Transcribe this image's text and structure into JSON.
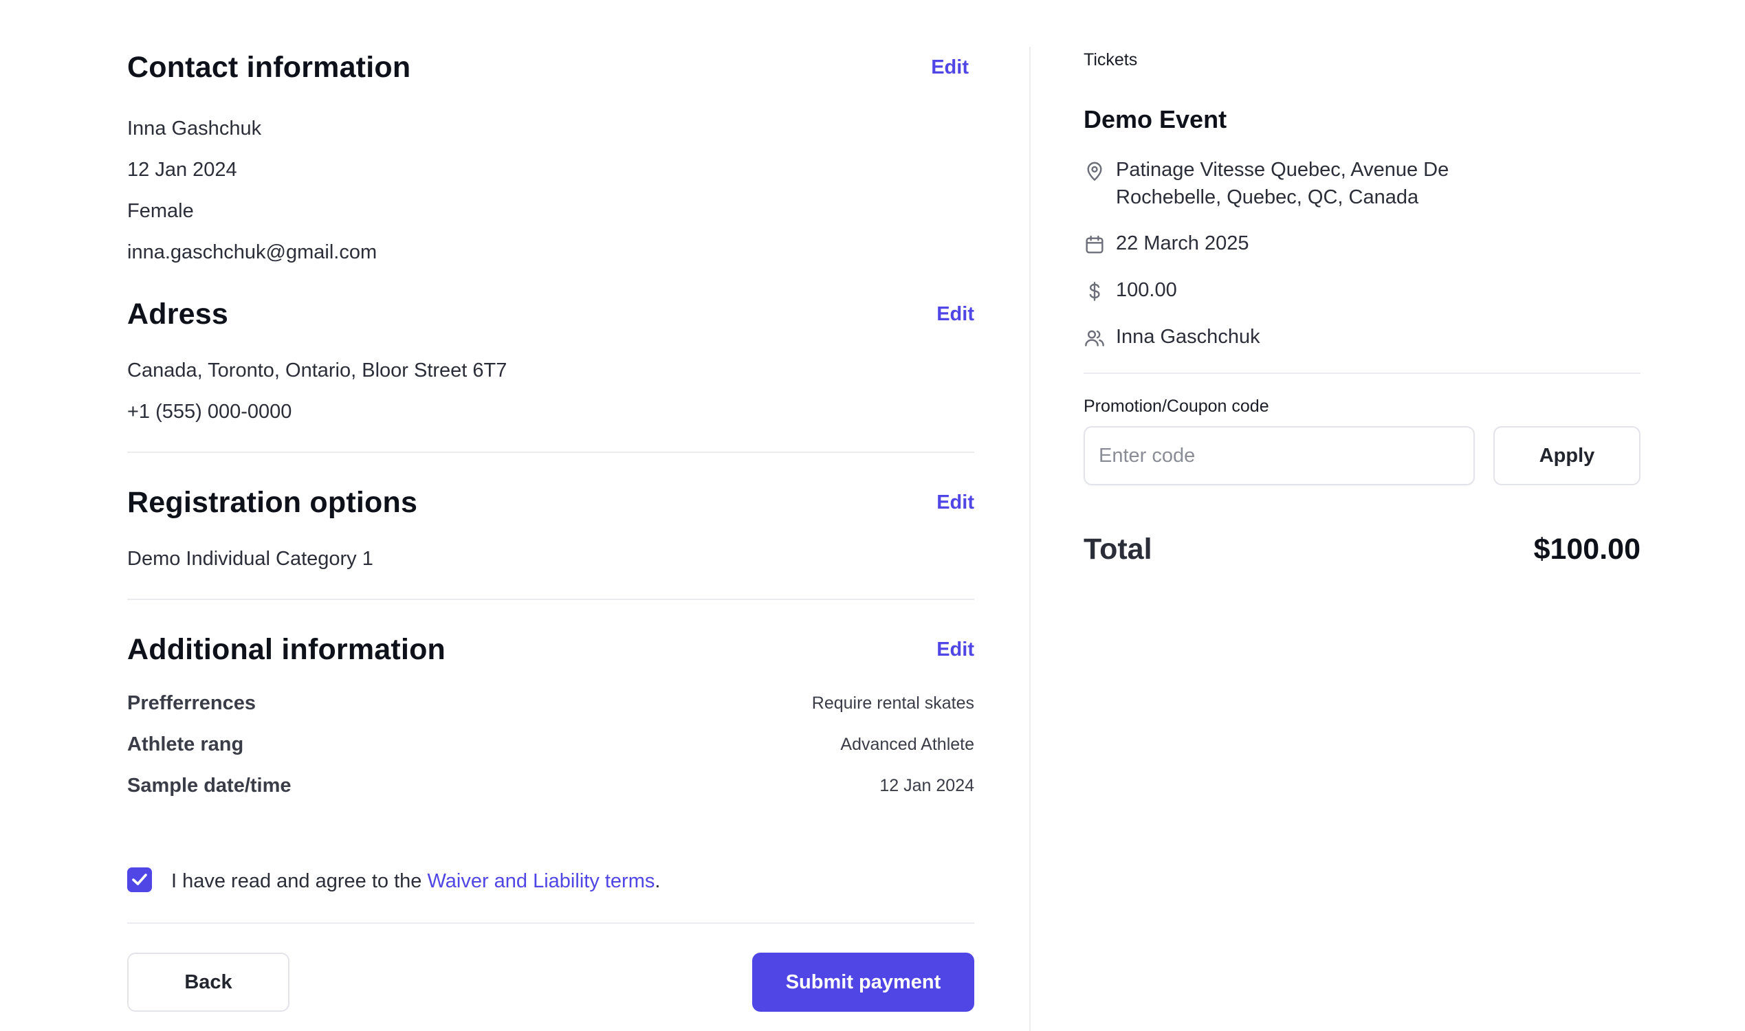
{
  "contact": {
    "title": "Contact information",
    "edit_label": "Edit",
    "name": "Inna Gashchuk",
    "date": "12 Jan 2024",
    "gender": "Female",
    "email": "inna.gaschchuk@gmail.com"
  },
  "address": {
    "title": "Adress",
    "edit_label": "Edit",
    "street": "Canada, Toronto, Ontario, Bloor Street 6T7",
    "phone": "+1 (555) 000-0000"
  },
  "registration": {
    "title": "Registration options",
    "edit_label": "Edit",
    "option": "Demo Individual Category 1"
  },
  "additional": {
    "title": "Additional information",
    "edit_label": "Edit",
    "rows": [
      {
        "label": "Prefferrences",
        "value": "Require rental skates"
      },
      {
        "label": "Athlete rang",
        "value": "Advanced Athlete"
      },
      {
        "label": "Sample date/time",
        "value": "12 Jan 2024"
      }
    ]
  },
  "agreement": {
    "checked": true,
    "text_before": "I have read and agree to the ",
    "link_text": "Waiver and Liability terms",
    "text_after": "."
  },
  "actions": {
    "back_label": "Back",
    "submit_label": "Submit payment"
  },
  "ticket": {
    "section_label": "Tickets",
    "event_name": "Demo Event",
    "location": "Patinage Vitesse Quebec, Avenue De Rochebelle, Quebec, QC, Canada",
    "date": "22 March 2025",
    "price": "100.00",
    "attendee": "Inna Gaschchuk",
    "icons": [
      "map-pin-icon",
      "calendar-icon",
      "dollar-icon",
      "users-icon"
    ]
  },
  "promo": {
    "label": "Promotion/Coupon code",
    "placeholder": "Enter code",
    "value": "",
    "apply_label": "Apply"
  },
  "total": {
    "label": "Total",
    "value": "$100.00"
  },
  "colors": {
    "accent": "#5046e5",
    "text": "#1a1d26",
    "border": "#e3e4ea"
  }
}
